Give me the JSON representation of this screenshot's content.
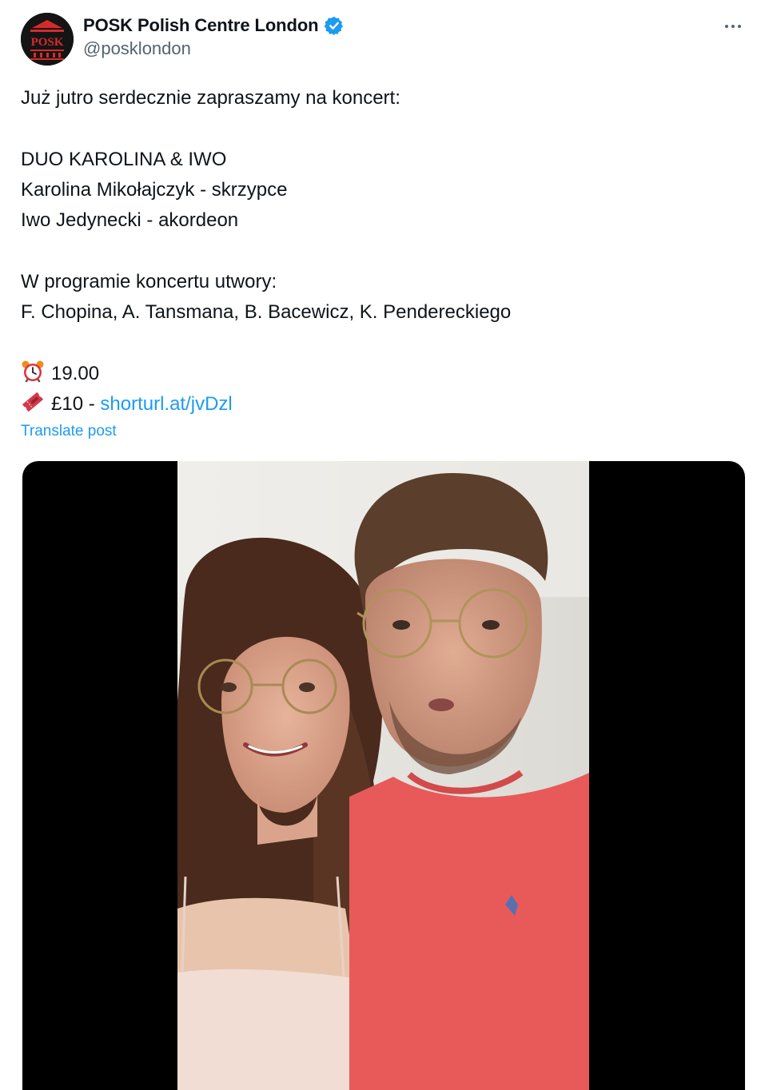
{
  "author": {
    "display_name": "POSK Polish Centre London",
    "handle": "@posklondon",
    "avatar_text": "POSK",
    "verified": true
  },
  "post": {
    "lines": [
      "Już jutro serdecznie zapraszamy na koncert:",
      "",
      "DUO KAROLINA & IWO",
      "Karolina Mikołajczyk - skrzypce",
      "Iwo Jedynecki - akordeon",
      "",
      "W programie koncertu utwory:",
      "F. Chopina, A. Tansmana, B. Bacewicz, K. Pendereckiego",
      ""
    ],
    "time_icon": "alarm-clock-icon",
    "time_text": "19.00",
    "ticket_icon": "ticket-icon",
    "price_text": "£10 - ",
    "link_text": "shorturl.at/jvDzl",
    "translate_label": "Translate post"
  },
  "colors": {
    "link": "#1d9bf0",
    "secondary_text": "#536471",
    "verified_badge": "#1d9bf0",
    "avatar_accent": "#d62b2b"
  },
  "menu_icon": "more-horizontal-icon",
  "media": {
    "type": "video"
  }
}
